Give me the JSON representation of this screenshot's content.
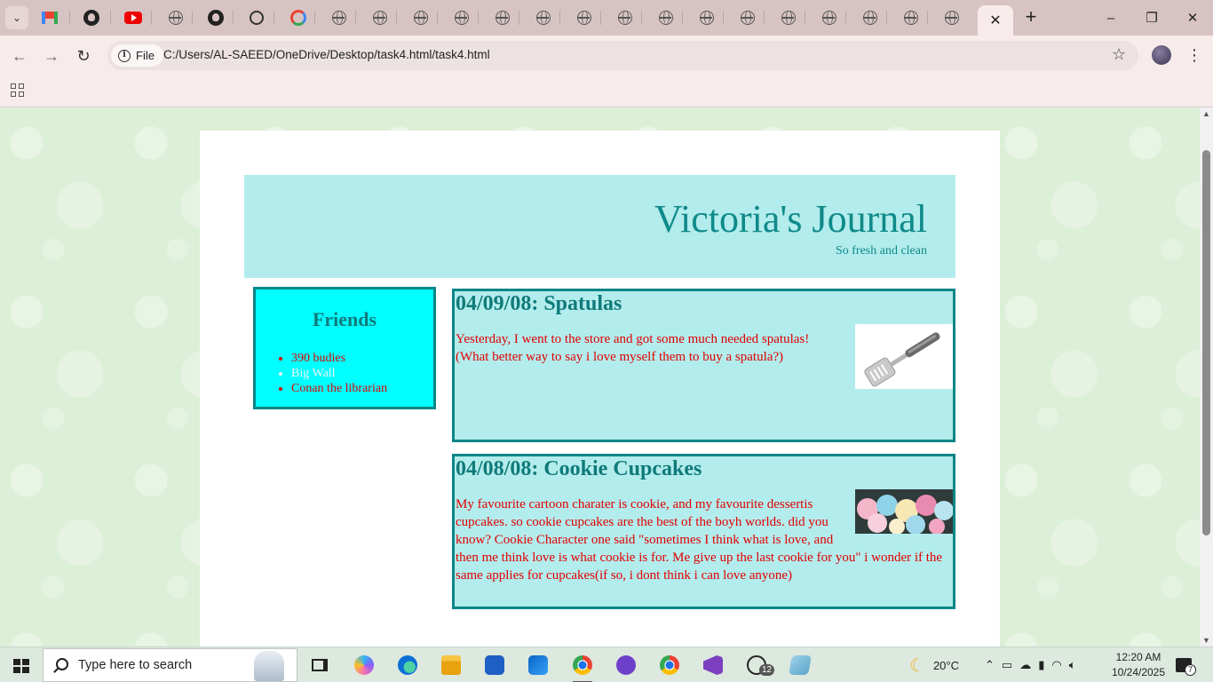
{
  "browser": {
    "address": {
      "scheme_label": "File",
      "url": "C:/Users/AL-SAEED/OneDrive/Desktop/task4.html/task4.html"
    },
    "tabs": [
      {
        "icon": "tab-search-icon"
      },
      {
        "icon": "gmail-icon"
      },
      {
        "icon": "github-icon"
      },
      {
        "icon": "youtube-icon"
      },
      {
        "icon": "globe-icon"
      },
      {
        "icon": "github-icon"
      },
      {
        "icon": "chatgpt-icon"
      },
      {
        "icon": "google-icon"
      },
      {
        "icon": "globe-icon"
      }
    ],
    "close_tab_glyph": "✕",
    "new_tab_glyph": "+",
    "window_controls": {
      "minimize": "–",
      "restore": "❐",
      "close": "✕"
    }
  },
  "journal": {
    "title": "Victoria's Journal",
    "tagline": "So fresh and clean",
    "friends": {
      "heading": "Friends",
      "items": [
        "390 budies",
        "Big Wall",
        "Conan the librarian"
      ]
    },
    "posts": [
      {
        "title": "04/09/08: Spatulas",
        "body": "Yesterday, I went to the store and got some much needed spatulas! (What better way to say i love myself them to buy a spatula?)"
      },
      {
        "title": "04/08/08: Cookie Cupcakes",
        "body": "My favourite cartoon charater is cookie, and my favourite dessertis cupcakes. so cookie cupcakes are the best of the boyh worlds. did you know? Cookie Character one said \"sometimes I think what is love, and then me think love is what cookie is for. Me give up the last cookie for you\" i wonder if the same applies for cupcakes(if so, i dont think i can love anyone)"
      }
    ]
  },
  "colors": {
    "header_bg": "#b3ecec",
    "title_teal": "#0f8a8a",
    "friends_bg": "#00ffff",
    "post_border": "#0b8686",
    "body_red": "#e00000"
  },
  "taskbar": {
    "search_placeholder": "Type here to search",
    "weather": "20°C",
    "time": "12:20 AM",
    "date": "10/24/2025",
    "whatsapp_badge": "12",
    "notification_count": "7"
  }
}
